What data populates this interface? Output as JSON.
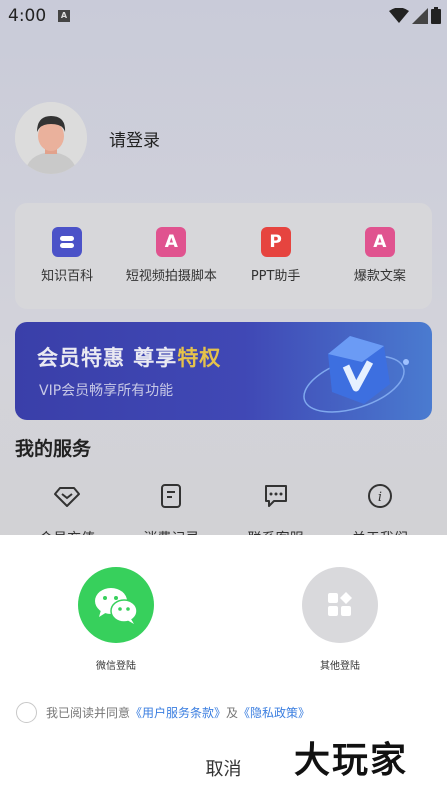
{
  "status_bar": {
    "time": "4:00",
    "notification_icon": "A"
  },
  "profile": {
    "login_text": "请登录"
  },
  "tools": [
    {
      "label": "知识百科",
      "icon": "book-icon",
      "color": "#4b52c8",
      "glyph": ""
    },
    {
      "label": "短视频拍摄脚本",
      "icon": "script-a-icon",
      "color": "#e0538f",
      "glyph": "A"
    },
    {
      "label": "PPT助手",
      "icon": "ppt-p-icon",
      "color": "#e6443f",
      "glyph": "P"
    },
    {
      "label": "爆款文案",
      "icon": "copy-a-icon",
      "color": "#e0538f",
      "glyph": "A"
    }
  ],
  "vip_banner": {
    "title_part1": "会员特惠 尊享",
    "title_part2": "特权",
    "subtitle": "VIP会员畅享所有功能"
  },
  "services": {
    "title": "我的服务",
    "items": [
      {
        "label": "会员充值",
        "icon": "diamond-icon"
      },
      {
        "label": "消费记录",
        "icon": "receipt-icon"
      },
      {
        "label": "联系客服",
        "icon": "chat-icon"
      },
      {
        "label": "关于我们",
        "icon": "info-icon"
      }
    ]
  },
  "login_sheet": {
    "wechat_label": "微信登陆",
    "other_label": "其他登陆",
    "agree_prefix": "我已阅读并同意",
    "terms_link": "《用户服务条款》",
    "and_text": "及",
    "privacy_link": "《隐私政策》",
    "cancel_label": "取消",
    "watermark": "大玩家"
  },
  "colors": {
    "wechat_green": "#37d05c",
    "link_blue": "#3a7ee0",
    "vip_gold": "#e5c24b"
  }
}
